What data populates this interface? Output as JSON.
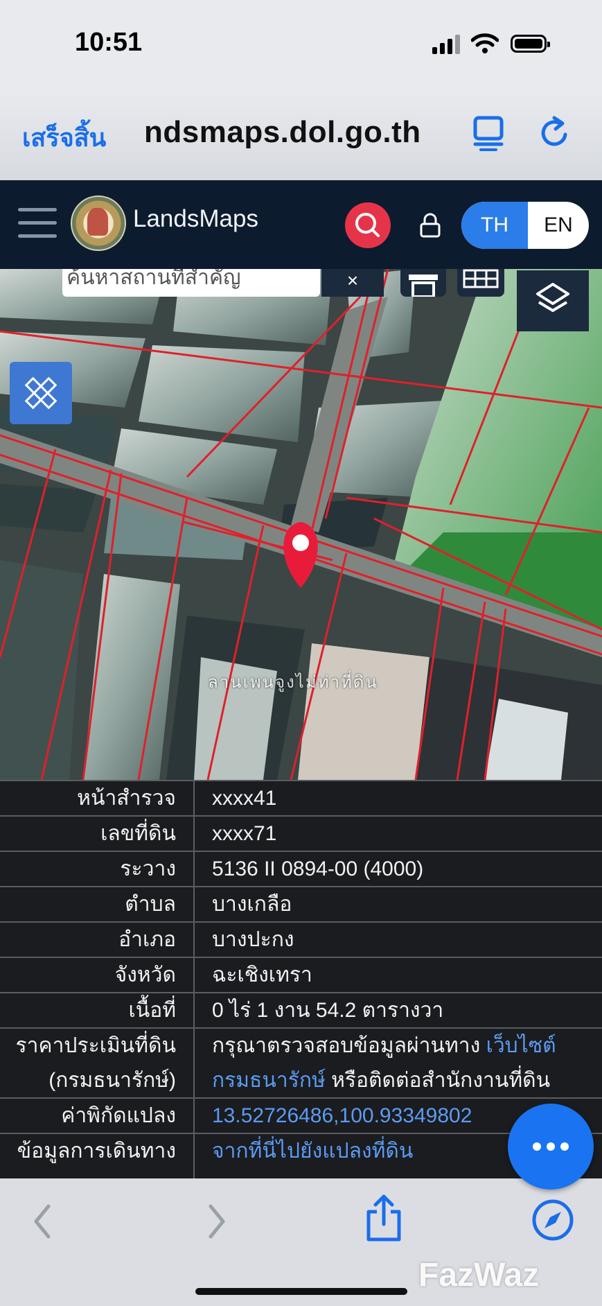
{
  "status_bar": {
    "time": "10:51"
  },
  "browser": {
    "done_label": "เสร็จสิ้น",
    "url": "ndsmaps.dol.go.th"
  },
  "app_header": {
    "brand": "LandsMaps",
    "lang_th": "TH",
    "lang_en": "EN"
  },
  "map": {
    "search_placeholder": "ค้นหาสถานที่สำคัญ",
    "clear_label": "×",
    "parcel_label": "ลานเพนจูงไม่ท่าที่ดิน"
  },
  "parcel_info": {
    "rows": [
      {
        "label": "หน้าสำรวจ",
        "value": "xxxx41"
      },
      {
        "label": "เลขที่ดิน",
        "value": "xxxx71"
      },
      {
        "label": "ระวาง",
        "value": "5136 II 0894-00 (4000)"
      },
      {
        "label": "ตำบล",
        "value": "บางเกลือ"
      },
      {
        "label": "อำเภอ",
        "value": "บางปะกง"
      },
      {
        "label": "จังหวัด",
        "value": "ฉะเชิงเทรา"
      },
      {
        "label": "เนื้อที่",
        "value": "0 ไร่ 1 งาน 54.2 ตารางวา"
      }
    ],
    "appraisal": {
      "label_line1": "ราคาประเมินที่ดิน",
      "label_line2": "(กรมธนารักษ์)",
      "text_line1": "กรุณาตรวจสอบข้อมูลผ่านทาง",
      "link_line1": "เว็บไซต์",
      "link_line2": "กรมธนารักษ์",
      "text_line2": "หรือติดต่อสำนักงานที่ดิน"
    },
    "coordinates": {
      "label": "ค่าพิกัดแปลง",
      "value": "13.52726486,100.93349802"
    },
    "directions": {
      "label": "ข้อมูลการเดินทาง",
      "value": "จากที่นี่ไปยังแปลงที่ดิน"
    }
  },
  "watermark": "FazWaz",
  "colors": {
    "header_bg": "#0d1b2e",
    "accent_blue": "#2b7de9",
    "search_red": "#e5344a",
    "parcel_red": "#e0202a",
    "link": "#5d9bf2"
  }
}
